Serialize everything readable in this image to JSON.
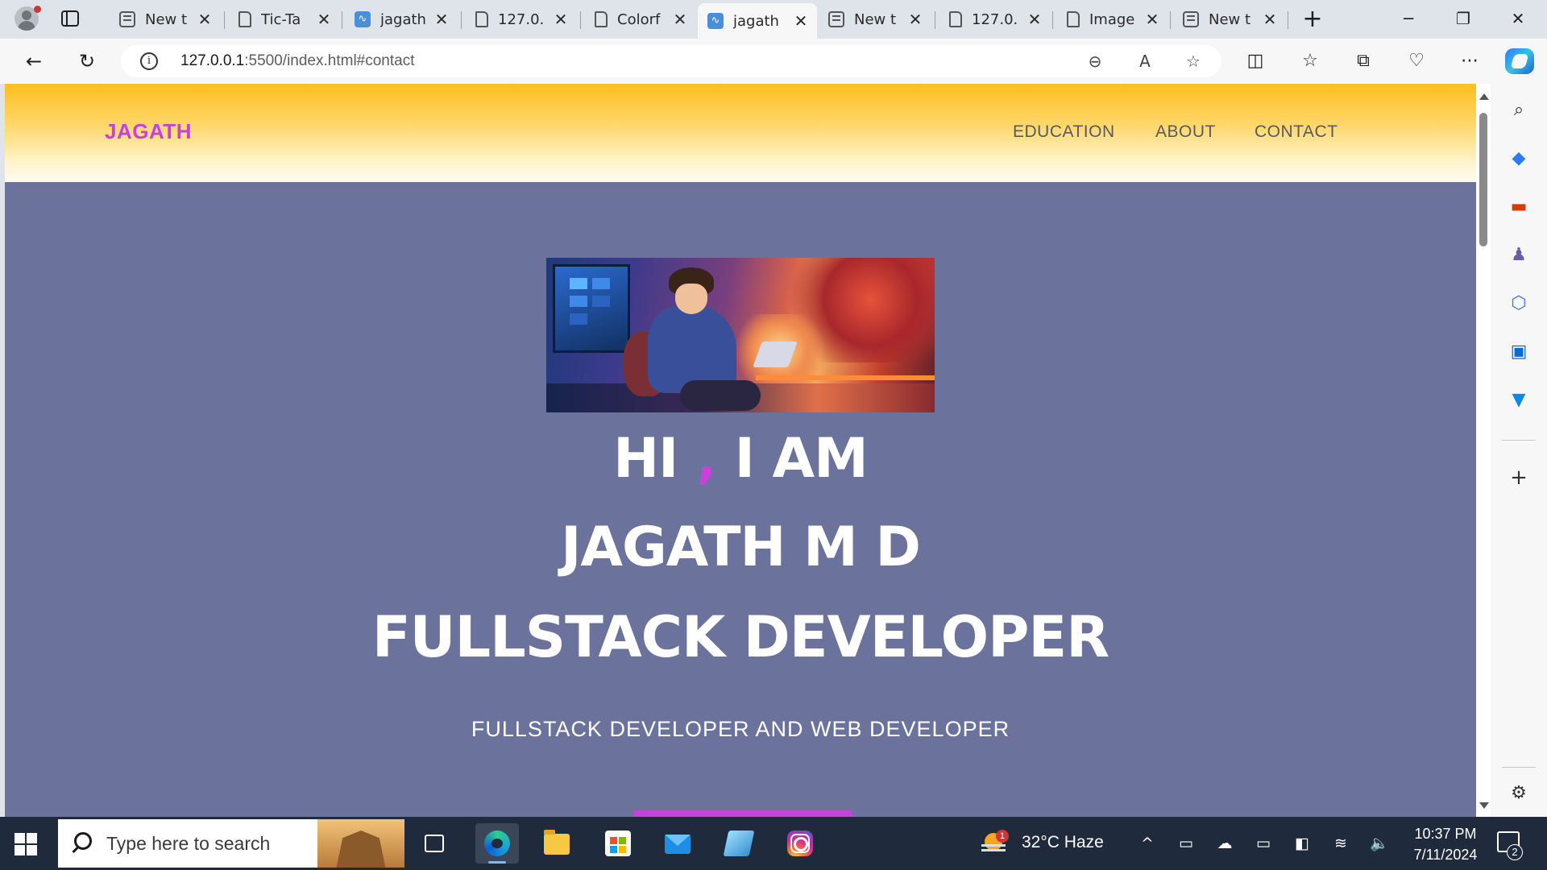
{
  "browser": {
    "tabs": [
      {
        "title": "New t",
        "icon": "new-tab-page-icon"
      },
      {
        "title": "Tic-Ta",
        "icon": "page-icon"
      },
      {
        "title": "jagath",
        "icon": "site-favicon"
      },
      {
        "title": "127.0.",
        "icon": "page-icon"
      },
      {
        "title": "Colorf",
        "icon": "page-icon"
      },
      {
        "title": "jagath",
        "icon": "site-favicon",
        "active": true
      },
      {
        "title": "New t",
        "icon": "new-tab-page-icon"
      },
      {
        "title": "127.0.",
        "icon": "page-icon"
      },
      {
        "title": "Image",
        "icon": "page-icon"
      },
      {
        "title": "New t",
        "icon": "new-tab-page-icon"
      }
    ],
    "address_host": "127.0.0.1",
    "address_rest": ":5500/index.html#contact"
  },
  "site": {
    "logo": "JAGATH",
    "nav": [
      "EDUCATION",
      "ABOUT",
      "CONTACT"
    ],
    "hero": {
      "line1_a": "HI",
      "line1_comma": ",",
      "line1_b": "I AM",
      "line2": "JAGATH M D",
      "line3": "FULLSTACK DEVELOPER",
      "subtitle": "FULLSTACK DEVELOPER AND WEB DEVELOPER"
    },
    "colors": {
      "header": "#fdbf1f",
      "hero_bg": "#6b739d",
      "accent": "#c93fe0"
    }
  },
  "taskbar": {
    "search_placeholder": "Type here to search",
    "weather": "32°C  Haze",
    "weather_badge": "1",
    "time": "10:37 PM",
    "date": "7/11/2024",
    "notification_count": "2"
  }
}
